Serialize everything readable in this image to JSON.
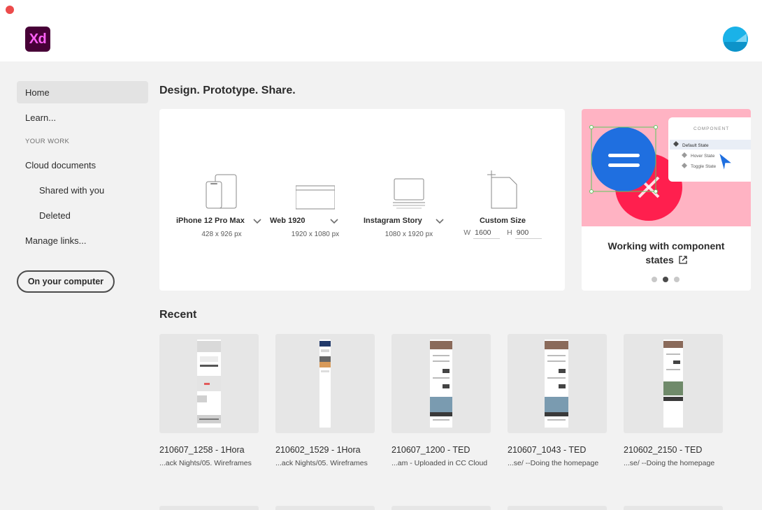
{
  "app": {
    "logo_text": "Xd"
  },
  "sidebar": {
    "items": [
      {
        "label": "Home",
        "active": true
      },
      {
        "label": "Learn..."
      }
    ],
    "section_label": "YOUR WORK",
    "work_items": [
      {
        "label": "Cloud documents"
      },
      {
        "label": "Shared with you",
        "indent": true
      },
      {
        "label": "Deleted",
        "indent": true
      },
      {
        "label": "Manage links..."
      }
    ],
    "computer_button": "On your computer"
  },
  "main": {
    "headline": "Design. Prototype. Share.",
    "presets": [
      {
        "name": "iPhone 12 Pro Max",
        "size": "428 x 926 px",
        "icon": "phone-icon"
      },
      {
        "name": "Web 1920",
        "size": "1920 x 1080 px",
        "icon": "browser-icon"
      },
      {
        "name": "Instagram Story",
        "size": "1080 x 1920 px",
        "icon": "tablet-icon"
      },
      {
        "name": "Custom Size",
        "icon": "custom-artboard-icon",
        "w_label": "W",
        "w_value": "1600",
        "h_label": "H",
        "h_value": "900"
      }
    ],
    "promo": {
      "title": "Working with component states",
      "panel_heading": "COMPONENT",
      "states": [
        "Default State",
        "Hover State",
        "Toggle State"
      ],
      "slide_count": 3,
      "active_slide": 2,
      "colors": {
        "background": "#ffb3c3",
        "blue": "#1f6fe0",
        "red": "#ff1f4e"
      }
    },
    "recent_title": "Recent",
    "recent": [
      {
        "name": "210607_1258 - 1Hora",
        "path": "...ack Nights/05. Wireframes"
      },
      {
        "name": "210602_1529 - 1Hora",
        "path": "...ack Nights/05. Wireframes"
      },
      {
        "name": "210607_1200 - TED",
        "path": "...am - Uploaded in CC Cloud"
      },
      {
        "name": "210607_1043 - TED",
        "path": "...se/ --Doing the homepage"
      },
      {
        "name": "210602_2150 - TED",
        "path": "...se/ --Doing the homepage"
      }
    ]
  },
  "colors": {
    "accent_red": "#ec4b4b",
    "xd_bg": "#470137",
    "xd_fg": "#ff61f6",
    "avatar": "#14a7e0"
  }
}
